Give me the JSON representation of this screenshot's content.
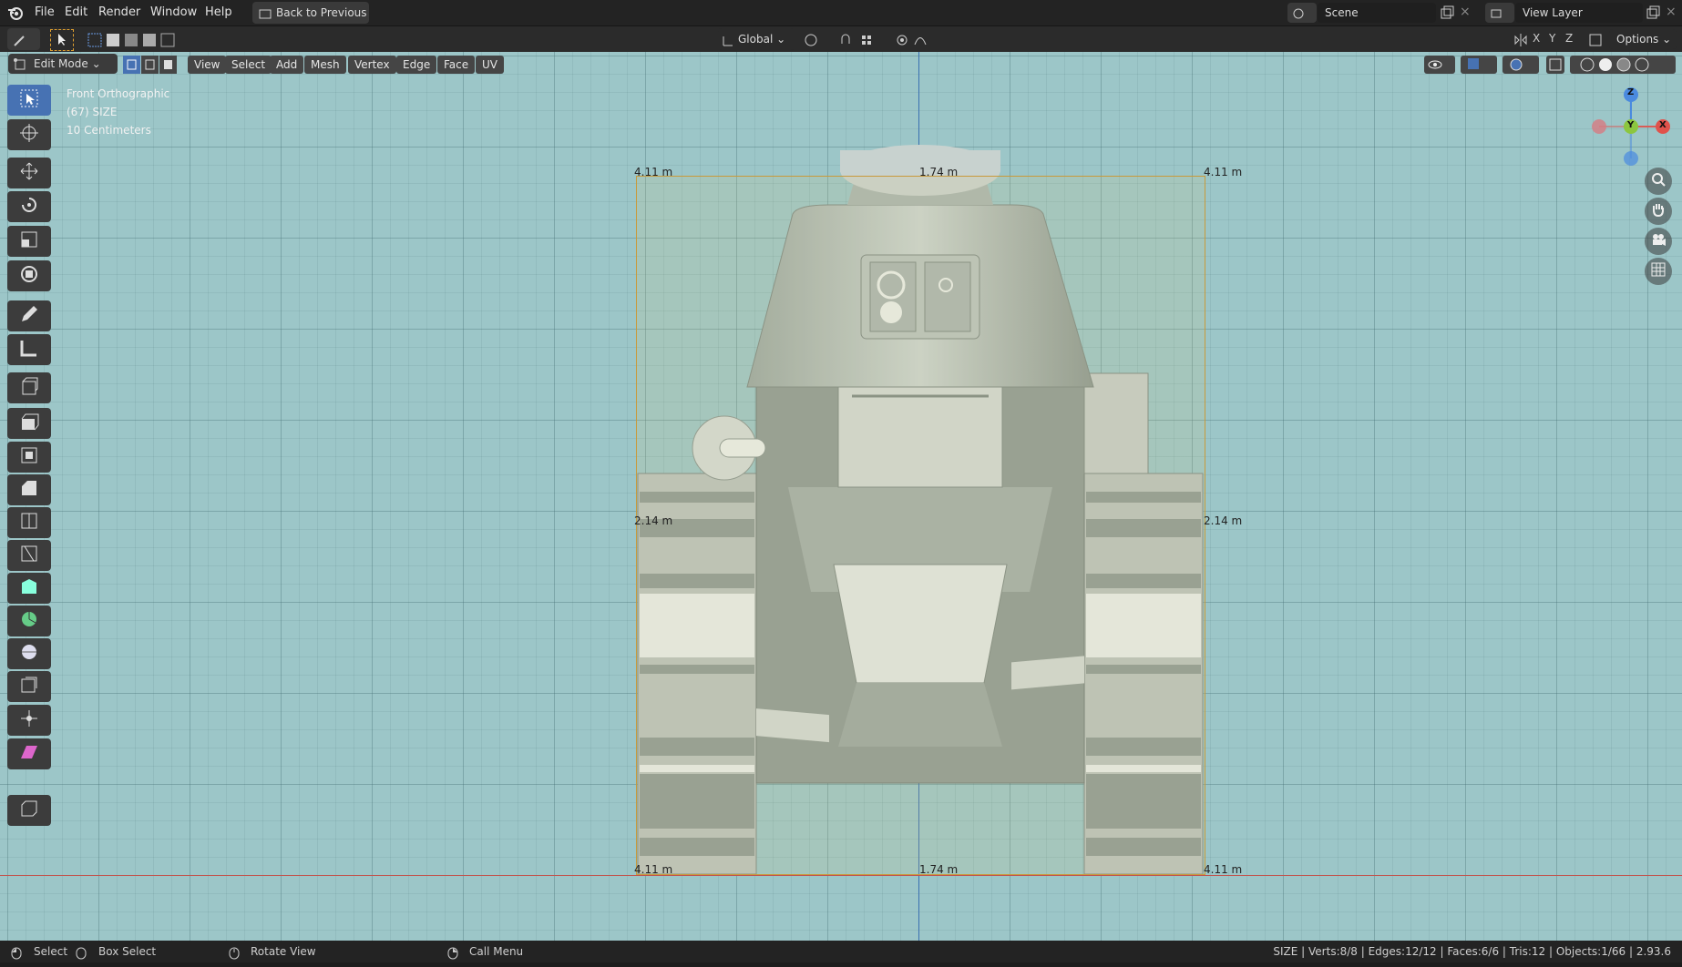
{
  "menu": [
    "File",
    "Edit",
    "Render",
    "Window",
    "Help"
  ],
  "back_button": "Back to Previous",
  "scene": {
    "label": "Scene"
  },
  "view_layer": {
    "label": "View Layer"
  },
  "tool_header": {
    "transform_orientation": "Global",
    "options": "Options",
    "axis": [
      "X",
      "Y",
      "Z"
    ]
  },
  "viewport_header": {
    "mode": "Edit Mode",
    "buttons": [
      "View",
      "Select",
      "Add",
      "Mesh",
      "Vertex",
      "Edge",
      "Face",
      "UV"
    ]
  },
  "overlay": {
    "view_name": "Front Orthographic",
    "object": "(67) SIZE",
    "scale": "10 Centimeters"
  },
  "measurements": {
    "top_left": "4.11 m",
    "top_mid": "1.74 m",
    "top_right": "4.11 m",
    "mid_left": "2.14 m",
    "mid_right": "2.14 m",
    "bot_left": "4.11 m",
    "bot_mid": "1.74 m",
    "bot_right": "4.11 m"
  },
  "gizmo": {
    "z": "Z",
    "y": "Y",
    "x": "X"
  },
  "statusbar": {
    "select": "Select",
    "box_select": "Box Select",
    "rotate": "Rotate View",
    "call_menu": "Call Menu",
    "stats": "SIZE | Verts:8/8 | Edges:12/12 | Faces:6/6 | Tris:12 | Objects:1/66 | 2.93.6"
  },
  "colors": {
    "viewport": "#9cc6c8",
    "active": "#4772b3",
    "bbox": "#c89a3c"
  }
}
